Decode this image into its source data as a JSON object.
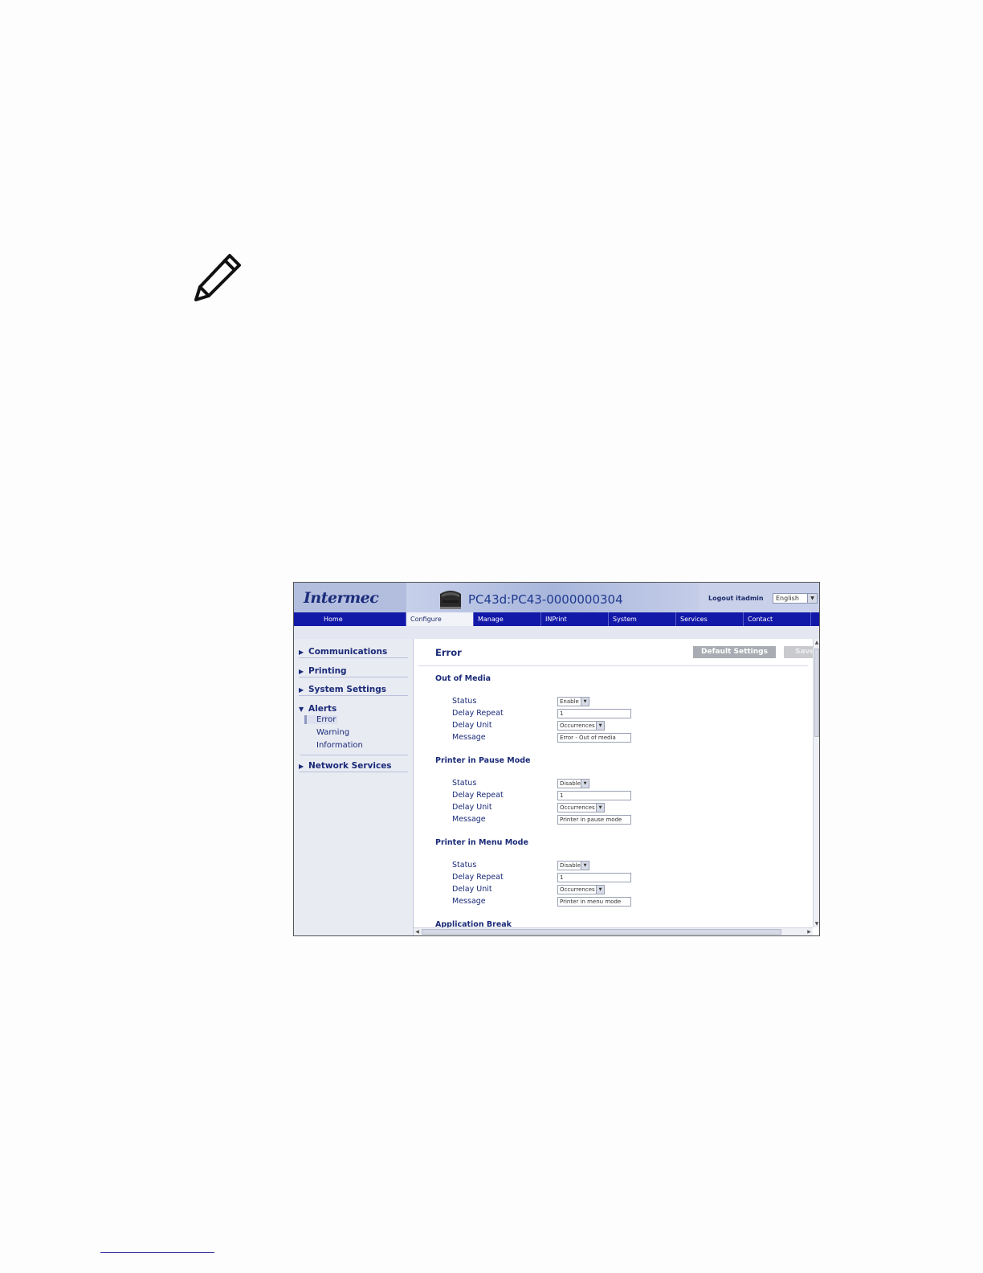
{
  "header": {
    "logo": "Intermec",
    "device_name": "PC43d:PC43-0000000304",
    "logout": "Logout itadmin",
    "language": "English"
  },
  "nav_tabs": [
    "Home",
    "Configure",
    "Manage",
    "INPrint",
    "System Information",
    "Services",
    "Contact"
  ],
  "active_tab": "Configure",
  "sidebar": {
    "items": [
      "Communications",
      "Printing",
      "System Settings",
      "Alerts",
      "Network Services"
    ],
    "alerts_sub": [
      "Error",
      "Warning",
      "Information"
    ],
    "selected_sub": "Error"
  },
  "content": {
    "title": "Error",
    "default_button": "Default Settings",
    "save_button": "Save",
    "sections": [
      {
        "title": "Out of Media",
        "status": "Enable",
        "delay_repeat": "1",
        "delay_unit": "Occurrences",
        "message": "Error - Out of media"
      },
      {
        "title": "Printer in Pause Mode",
        "status": "Disable",
        "delay_repeat": "1",
        "delay_unit": "Occurrences",
        "message": "Printer in pause mode"
      },
      {
        "title": "Printer in Menu Mode",
        "status": "Disable",
        "delay_repeat": "1",
        "delay_unit": "Occurrences",
        "message": "Printer in menu mode"
      }
    ],
    "labels": {
      "status": "Status",
      "delay_repeat": "Delay Repeat",
      "delay_unit": "Delay Unit",
      "message": "Message"
    },
    "next_section": "Application Break"
  }
}
